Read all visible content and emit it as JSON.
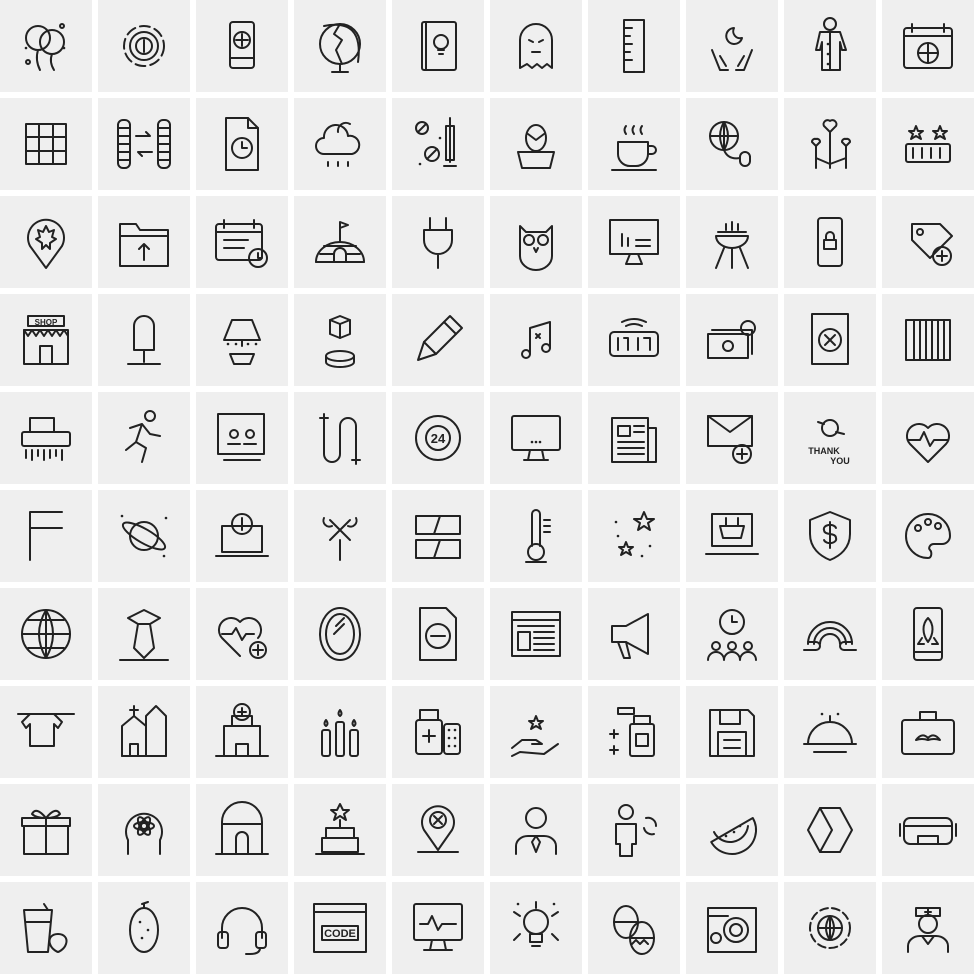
{
  "colors": {
    "tile_background": "#efefef",
    "gap": "#ffffff",
    "stroke": "#222222"
  },
  "icons": [
    "balloons",
    "dollar-target",
    "mobile-add",
    "globe-broken",
    "book-idea",
    "ghost",
    "ruler",
    "hands-moon",
    "shirt-person",
    "calendar-basketball",
    "grid",
    "coins-exchange",
    "file-clock",
    "cloud-moon-rain",
    "pills-syringe",
    "easter-egg-nest",
    "coffee-cup",
    "globe-mouse",
    "heart-balloons",
    "rating-stars-counter",
    "maple-leaf-pin",
    "folder-upload",
    "calendar-clock",
    "igloo",
    "plug",
    "owl",
    "monitor-chart",
    "grill",
    "mobile-lock",
    "tag-add",
    "shop",
    "popsicle",
    "lamp",
    "box-hologram",
    "marker-pen",
    "music-notes",
    "digital-clock",
    "money-exchange",
    "file-close",
    "accordion",
    "shredder",
    "running-man",
    "video-conference",
    "tube",
    "lifebuoy-24",
    "monitor",
    "newspaper",
    "mail-add",
    "thank-you",
    "heart-pulse",
    "flag",
    "planet",
    "laptop-dollar",
    "wrench-screwdriver",
    "panels",
    "thermometer",
    "stars",
    "laptop-cart",
    "shield-dollar",
    "palette",
    "globe",
    "tie",
    "heart-pulse-add",
    "mirror",
    "file-minus",
    "web-layout",
    "megaphone",
    "team-time",
    "rainbow",
    "mobile-rocket",
    "clothes-line-shirt",
    "church",
    "hospital",
    "candles",
    "medicine",
    "hand-stars",
    "medicine-bottle",
    "floppy-disk",
    "food-tray",
    "briefcase-mustache",
    "gift",
    "head-atom",
    "arch-door",
    "cake-star",
    "location-close",
    "businessman",
    "person-refresh",
    "watermelon",
    "hexagon-cube",
    "vr-headset",
    "juice-strawberry",
    "lemon",
    "headphones",
    "code-window",
    "monitor-pulse",
    "bulb-person",
    "easter-eggs",
    "map-target",
    "gear-globe",
    "nurse"
  ],
  "labels": {
    "shop": "SHOP",
    "lifebuoy": "24",
    "thank": "THANK",
    "you": "YOU",
    "code": "CODE"
  }
}
